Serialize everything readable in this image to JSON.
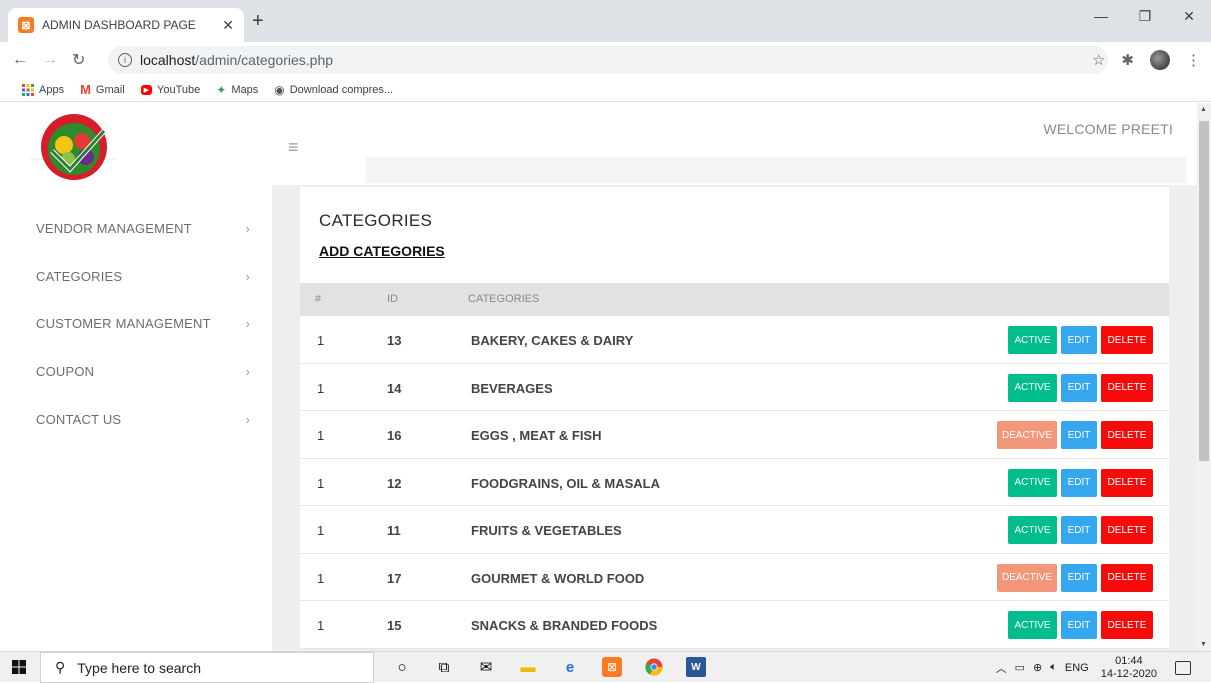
{
  "browser": {
    "tab_title": "ADMIN DASHBOARD PAGE",
    "url_host": "localhost",
    "url_path": "/admin/categories.php",
    "bookmarks": [
      "Apps",
      "Gmail",
      "YouTube",
      "Maps",
      "Download compres..."
    ]
  },
  "header": {
    "welcome": "WELCOME PREETI"
  },
  "sidebar": {
    "items": [
      {
        "label": "VENDOR MANAGEMENT"
      },
      {
        "label": "CATEGORIES"
      },
      {
        "label": "CUSTOMER MANAGEMENT"
      },
      {
        "label": "COUPON"
      },
      {
        "label": "CONTACT US"
      }
    ]
  },
  "main": {
    "title": "CATEGORIES",
    "add_link": "ADD CATEGORIES",
    "columns": [
      "#",
      "ID",
      "CATEGORIES"
    ],
    "buttons": {
      "active": "ACTIVE",
      "deactive": "DEACTIVE",
      "edit": "EDIT",
      "delete": "DELETE"
    },
    "rows": [
      {
        "num": "1",
        "id": "13",
        "name": "BAKERY, CAKES & DAIRY",
        "status": "ACTIVE"
      },
      {
        "num": "1",
        "id": "14",
        "name": "BEVERAGES",
        "status": "ACTIVE"
      },
      {
        "num": "1",
        "id": "16",
        "name": "EGGS , MEAT & FISH",
        "status": "DEACTIVE"
      },
      {
        "num": "1",
        "id": "12",
        "name": "FOODGRAINS, OIL & MASALA",
        "status": "ACTIVE"
      },
      {
        "num": "1",
        "id": "11",
        "name": "FRUITS & VEGETABLES",
        "status": "ACTIVE"
      },
      {
        "num": "1",
        "id": "17",
        "name": "GOURMET & WORLD FOOD",
        "status": "DEACTIVE"
      },
      {
        "num": "1",
        "id": "15",
        "name": "SNACKS & BRANDED FOODS",
        "status": "ACTIVE"
      }
    ]
  },
  "taskbar": {
    "search_placeholder": "Type here to search",
    "lang": "ENG",
    "time": "01:44",
    "date": "14-12-2020"
  },
  "colors": {
    "active": "#00bd8e",
    "deactive": "#f3967a",
    "edit": "#35a7ee",
    "delete": "#f60b0b"
  }
}
